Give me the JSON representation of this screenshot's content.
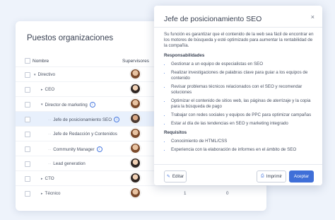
{
  "org_card": {
    "title": "Puestos organizaciones",
    "col_name": "Nombre",
    "col_supervisors": "Supervisores",
    "rows": [
      {
        "label": "Directivo",
        "caret": "▾",
        "avatar": "av-a",
        "count": ""
      },
      {
        "label": "CEO",
        "caret": "▸",
        "avatar": "av-b",
        "count": ""
      },
      {
        "label": "Director de marketing",
        "caret": "▾",
        "avatar": "av-a",
        "info": true,
        "count": ""
      },
      {
        "label": "Jefe de posicionamiento SEO",
        "caret": "",
        "avatar": "av-c",
        "info": true,
        "count": "",
        "selected": true
      },
      {
        "label": "Jefe de Redacción y Contenidos",
        "caret": "",
        "avatar": "av-a",
        "count": ""
      },
      {
        "label": "Community Manager",
        "caret": "",
        "avatar": "av-a",
        "info": true,
        "count": ""
      },
      {
        "label": "Lead generation",
        "caret": "",
        "avatar": "av-b",
        "count": ""
      },
      {
        "label": "CTO",
        "caret": "▸",
        "avatar": "av-b",
        "count": ""
      },
      {
        "label": "Técnico",
        "caret": "▸",
        "avatar": "av-a",
        "count": "1",
        "count2": "0"
      }
    ]
  },
  "panel": {
    "title": "Jefe de posicionamiento SEO",
    "close": "×",
    "description": "Su función es garantizar que el contenido de la web sea fácil de encontrar en los motores de búsqueda y esté optimizado para aumentar la rentabilidad de la compañía.",
    "resp_heading": "Responsabilidades",
    "responsibilities": [
      "Gestionar a un equipo de especialistas en SEO",
      "Realizar investigaciones de palabras clave para guiar a los equipos de contenido",
      "Revisar problemas técnicos relacionados con el SEO y recomendar soluciones",
      "Optimizar el contenido de sitios web, las páginas de aterrizaje y la copia para la búsqueda de pago",
      "Trabajar con redes sociales y equipos de PPC para optimizar campañas",
      "Estar al día de las tendencias en SEO y marketing integrado"
    ],
    "req_heading": "Requisitos",
    "requirements": [
      "Conocimiento de HTML/CSS",
      "Experiencia con la elaboración de informes en el ámbito de SEO"
    ],
    "edit_label": "Editar",
    "print_label": "Imprimir",
    "accept_label": "Aceptar"
  },
  "icons": {
    "edit": "pencil-icon",
    "print": "printer-icon",
    "info": "info-icon",
    "close": "close-icon"
  },
  "colors": {
    "accent": "#3f6fd8",
    "selected_row": "#e8f0fc"
  }
}
